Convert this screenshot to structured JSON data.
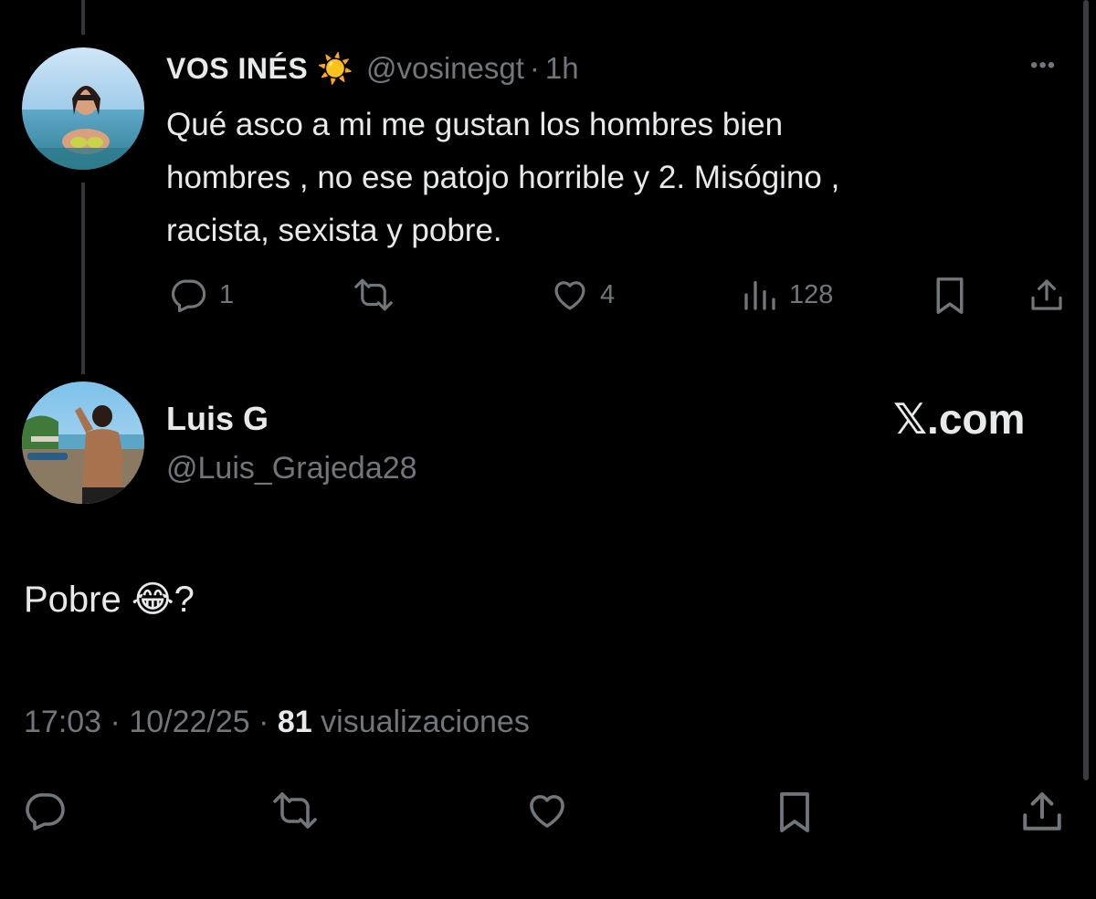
{
  "parent_tweet": {
    "display_name": "VOS INÉS",
    "display_name_emoji": "☀️",
    "handle": "@vosinesgt",
    "separator": "·",
    "time_ago": "1h",
    "more_label": "•••",
    "text_lines": [
      "Qué asco a mi me gustan los hombres bien",
      "hombres , no ese patojo horrible y 2. Misógino ,",
      "racista, sexista y pobre."
    ],
    "actions": {
      "reply_icon": "reply-icon",
      "reply_count": "1",
      "retweet_icon": "retweet-icon",
      "like_icon": "heart-icon",
      "like_count": "4",
      "views_icon": "views-icon",
      "view_count": "128",
      "bookmark_icon": "bookmark-icon",
      "share_icon": "share-icon"
    }
  },
  "main_tweet": {
    "display_name": "Luis G",
    "handle": "@Luis_Grajeda28",
    "watermark": "𝕏.com",
    "text": "Pobre",
    "text_emoji": "😂",
    "text_suffix": "?",
    "meta": {
      "time": "17:03",
      "sep1": " · ",
      "date": "10/22/25",
      "sep2": " · ",
      "views_count": "81",
      "views_label": " visualizaciones"
    },
    "actions": {
      "reply_icon": "reply-icon",
      "retweet_icon": "retweet-icon",
      "like_icon": "heart-icon",
      "bookmark_icon": "bookmark-icon",
      "share_icon": "share-icon"
    }
  },
  "colors": {
    "background": "#000000",
    "text_primary": "#e7e9ea",
    "text_secondary": "#71767b",
    "thread_line": "#333639"
  }
}
